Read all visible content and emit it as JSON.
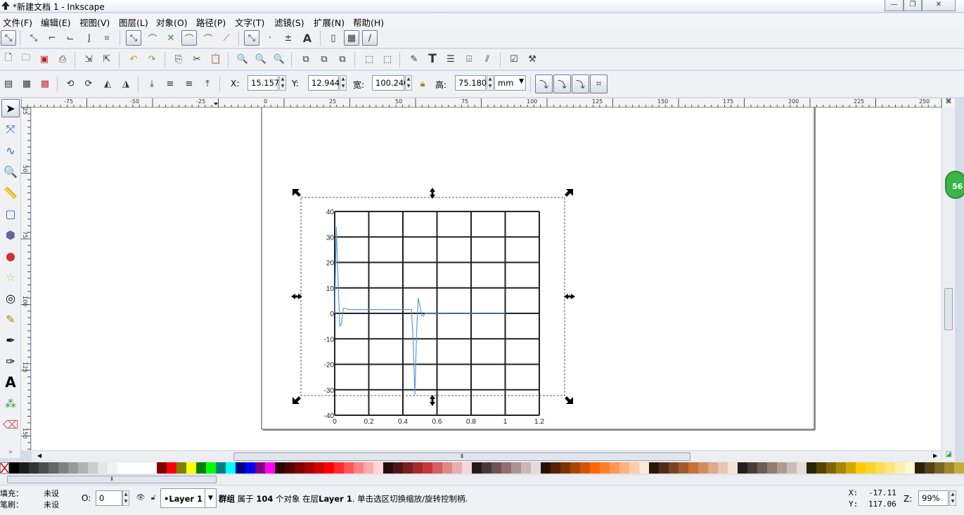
{
  "window": {
    "title": "*新建文档 1 - Inkscape"
  },
  "menu": [
    "文件(F)",
    "编辑(E)",
    "视图(V)",
    "图层(L)",
    "对象(O)",
    "路径(P)",
    "文字(T)",
    "滤镜(S)",
    "扩展(N)",
    "帮助(H)"
  ],
  "toolcontrols": {
    "x_label": "X:",
    "x_value": "15.157",
    "y_label": "Y:",
    "y_value": "12.944",
    "w_label": "宽:",
    "w_value": "100.240",
    "h_label": "高:",
    "h_value": "75.180",
    "unit": "mm"
  },
  "hruler_labels": [
    "-75",
    "-50",
    "-25",
    "0",
    "25",
    "50",
    "75",
    "100",
    "125",
    "150",
    "175",
    "200",
    "225",
    "250"
  ],
  "vruler_labels": [
    "25",
    "50",
    "75",
    "100",
    "125",
    "150"
  ],
  "chart_data": {
    "type": "line",
    "title": "",
    "xlabel": "",
    "ylabel": "",
    "xlim": [
      0,
      1.2
    ],
    "ylim": [
      -40,
      40
    ],
    "xticks": [
      "0",
      "0.2",
      "0.4",
      "0.6",
      "0.8",
      "1",
      "1.2"
    ],
    "yticks": [
      "40",
      "30",
      "20",
      "10",
      "0",
      "-10",
      "-20",
      "-30",
      "-40"
    ],
    "grid": true,
    "line_color": "#5b9bd5",
    "series": [
      {
        "x": [
          0,
          0.01,
          0.02,
          0.03,
          0.04,
          0.05,
          0.06,
          0.08,
          0.1,
          0.2,
          0.3,
          0.4,
          0.45,
          0.46,
          0.47,
          0.48,
          0.49,
          0.5,
          0.51,
          0.52,
          0.53,
          0.55,
          0.6,
          0.8,
          1.0
        ],
        "y": [
          0,
          34,
          12,
          -5,
          -4,
          2,
          2,
          1.5,
          1.5,
          1.5,
          1.5,
          1.5,
          1.5,
          -10,
          -32,
          -8,
          6,
          3,
          -1,
          -1,
          0,
          0,
          0,
          0,
          0
        ]
      }
    ]
  },
  "palette": [
    "#000000",
    "#1c1c1c",
    "#333333",
    "#4d4d4d",
    "#666666",
    "#808080",
    "#999999",
    "#b3b3b3",
    "#cccccc",
    "#e6e6e6",
    "#f2f2f2",
    "#ffffff",
    "#ffffff",
    "#ffffff",
    "#ffffff",
    "#800000",
    "#ff0000",
    "#808000",
    "#ffff00",
    "#008000",
    "#00ff00",
    "#008080",
    "#00ffff",
    "#000080",
    "#0000ff",
    "#800080",
    "#ff00ff",
    "#2b0000",
    "#550000",
    "#800000",
    "#aa0000",
    "#d40000",
    "#ff0000",
    "#ff2a2a",
    "#ff5555",
    "#ff8080",
    "#ffaaaa",
    "#ffd5d5",
    "#280b0b",
    "#501616",
    "#782121",
    "#a02c2c",
    "#c83737",
    "#d35f5f",
    "#de8787",
    "#e9afaf",
    "#f4d7d7",
    "#241c1c",
    "#483737",
    "#6c5353",
    "#916f6f",
    "#ac9393",
    "#c8b7b7",
    "#e3dbdb",
    "#2b1100",
    "#552200",
    "#803300",
    "#aa4400",
    "#d45500",
    "#ff6600",
    "#ff7f2a",
    "#ff9955",
    "#ffb380",
    "#ffccaa",
    "#ffe6d5",
    "#28170b",
    "#502d16",
    "#784421",
    "#a05a2c",
    "#c87137",
    "#d38d5f",
    "#deaa87",
    "#e9c6af",
    "#f4e3d7",
    "#241f1c",
    "#483e37",
    "#6c5d53",
    "#917c6f",
    "#ac9d93",
    "#c8beb7",
    "#e3dedb",
    "#2b2200",
    "#554400",
    "#806600",
    "#aa8800",
    "#d4aa00",
    "#ffcc00",
    "#ffd42a",
    "#ffdd55",
    "#ffe680",
    "#ffeeaa",
    "#fff6d5",
    "#28220b",
    "#504416",
    "#786721",
    "#a0892c",
    "#c8ab37"
  ],
  "status": {
    "fill_label": "填充：",
    "fill_value": "未设",
    "stroke_label": "笔刷：",
    "stroke_value": "未设",
    "opacity_label": "O:",
    "opacity_value": "0",
    "layer": "•Layer 1",
    "message_bold1": "群组",
    "message_mid1": " 属于 ",
    "message_bold2": "104",
    "message_mid2": " 个对象 在层",
    "message_bold3": "Layer 1",
    "message_tail": ". 单击选区切换缩放/旋转控制柄.",
    "cursor_x_label": "X:",
    "cursor_x": "-17.11",
    "cursor_y_label": "Y:",
    "cursor_y": "117.06",
    "zoom_label": "Z:",
    "zoom": "99%"
  },
  "badge": "56"
}
